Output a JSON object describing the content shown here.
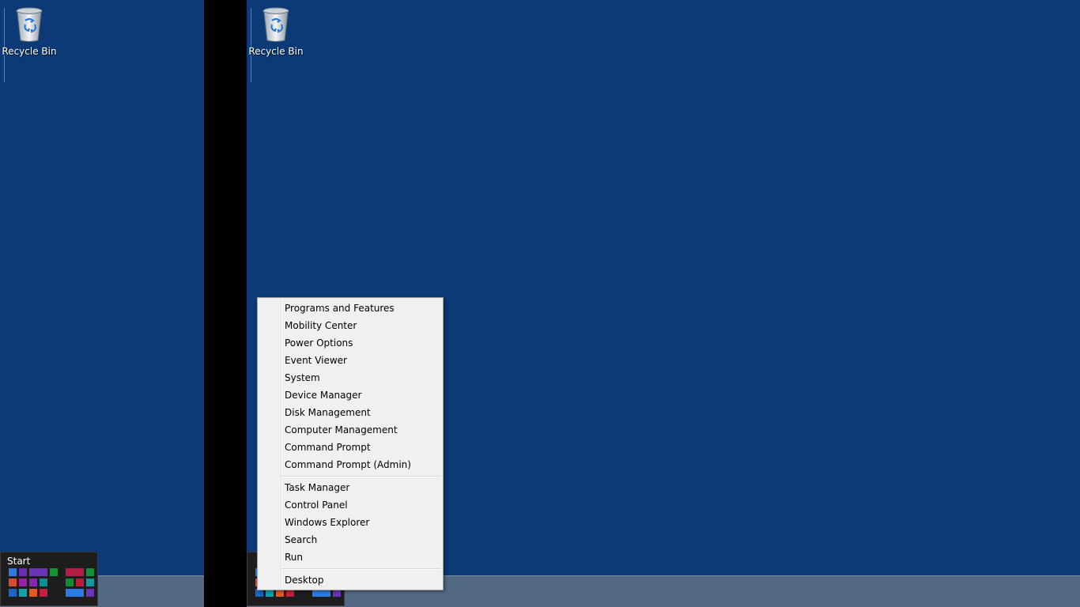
{
  "desktop_left": {
    "recycle_bin_label": "Recycle Bin",
    "start_label": "Start"
  },
  "desktop_right": {
    "recycle_bin_label": "Recycle Bin"
  },
  "context_menu": {
    "groups": [
      [
        "Programs and Features",
        "Mobility Center",
        "Power Options",
        "Event Viewer",
        "System",
        "Device Manager",
        "Disk Management",
        "Computer Management",
        "Command Prompt",
        "Command Prompt (Admin)"
      ],
      [
        "Task Manager",
        "Control Panel",
        "Windows Explorer",
        "Search",
        "Run"
      ],
      [
        "Desktop"
      ]
    ]
  },
  "colors": {
    "desktop_background": "#0b3a76",
    "taskbar": "#536984",
    "menu_background": "#f0f0f0",
    "divider": "#000000"
  }
}
